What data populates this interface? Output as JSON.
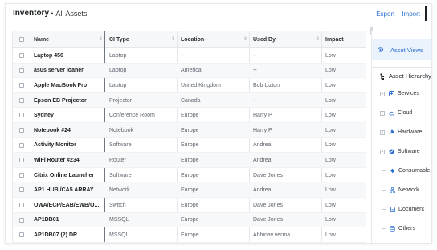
{
  "header": {
    "title": "Inventory",
    "separator": "-",
    "subtitle": "All Assets",
    "export_label": "Export",
    "import_label": "Import"
  },
  "table": {
    "columns": [
      "Name",
      "CI Type",
      "Location",
      "Used By",
      "Impact"
    ],
    "rows": [
      {
        "name": "Laptop 456",
        "ci_type": "Laptop",
        "location": "--",
        "used_by": "--",
        "impact": "Low"
      },
      {
        "name": "asus server loaner",
        "ci_type": "Laptop",
        "location": "America",
        "used_by": "--",
        "impact": "Low"
      },
      {
        "name": "Apple MacBook Pro",
        "ci_type": "Laptop",
        "location": "United Kingdom",
        "used_by": "Bob Lizton",
        "impact": "Low"
      },
      {
        "name": "Epson EB Projector",
        "ci_type": "Projector",
        "location": "Canada",
        "used_by": "--",
        "impact": "Low"
      },
      {
        "name": "Sydney",
        "ci_type": "Conference Room",
        "location": "Europe",
        "used_by": "Harry P",
        "impact": "Low"
      },
      {
        "name": "Notebook #24",
        "ci_type": "Notebook",
        "location": "Europe",
        "used_by": "Harry P",
        "impact": "Low"
      },
      {
        "name": "Activity Monitor",
        "ci_type": "Software",
        "location": "Europe",
        "used_by": "Andrea",
        "impact": "Low"
      },
      {
        "name": "WiFi Router #234",
        "ci_type": "Router",
        "location": "Europe",
        "used_by": "Andrea",
        "impact": "Low"
      },
      {
        "name": "Citrix Online Launcher",
        "ci_type": "Software",
        "location": "Europe",
        "used_by": "Dave Jones",
        "impact": "Low"
      },
      {
        "name": "AP1 HUB /CA5 ARRAY",
        "ci_type": "Network",
        "location": "Europe",
        "used_by": "Andrea",
        "impact": "Low"
      },
      {
        "name": "OWA/ECP/EAB/EWB/O...",
        "ci_type": "Switch",
        "location": "Europe",
        "used_by": "Dave Jones",
        "impact": "Low"
      },
      {
        "name": "AP1DB01",
        "ci_type": "MSSQL",
        "location": "Europe",
        "used_by": "Dave Jones",
        "impact": "Low"
      },
      {
        "name": "AP1DB07 (2) DR",
        "ci_type": "MSSQL",
        "location": "Europe",
        "used_by": "Abhinav.verma",
        "impact": "Low"
      }
    ]
  },
  "sidebar": {
    "views_label": "Asset Views",
    "views_icon": "eye-icon",
    "hierarchy_label": "Asset Hierarchy",
    "hierarchy_icon": "hierarchy-icon",
    "top_items": [
      {
        "label": "Services",
        "icon": "services-icon"
      },
      {
        "label": "Cloud",
        "icon": "cloud-icon"
      },
      {
        "label": "Hardware",
        "icon": "hardware-icon"
      },
      {
        "label": "Software",
        "icon": "software-icon"
      }
    ],
    "sub_items": [
      {
        "label": "Consumable",
        "icon": "consumable-icon"
      },
      {
        "label": "Network",
        "icon": "network-icon"
      },
      {
        "label": "Document",
        "icon": "document-icon"
      },
      {
        "label": "Others",
        "icon": "others-icon"
      }
    ]
  },
  "colors": {
    "accent": "#2c6fd1",
    "selected_bg": "#eaf2fc",
    "row_alt": "#f7f8fa"
  }
}
